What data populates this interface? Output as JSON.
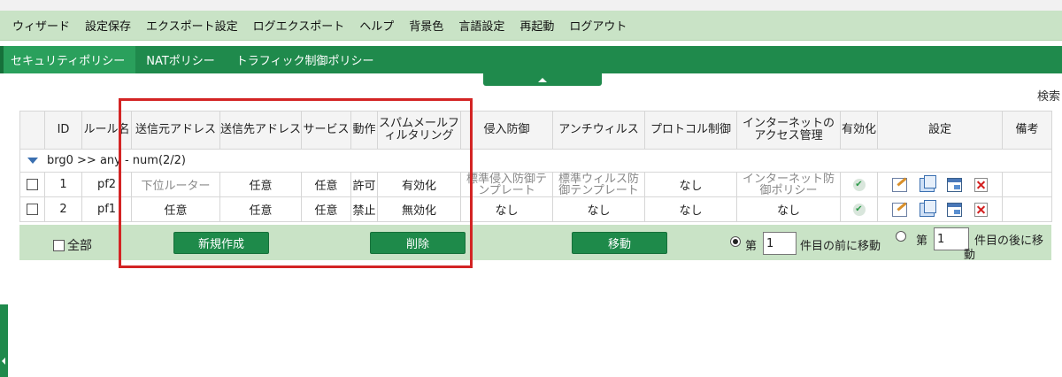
{
  "menu": [
    "ウィザード",
    "設定保存",
    "エクスポート設定",
    "ログエクスポート",
    "ヘルプ",
    "背景色",
    "言語設定",
    "再起動",
    "ログアウト"
  ],
  "tabs": [
    "セキュリティポリシー",
    "NATポリシー",
    "トラフィック制御ポリシー"
  ],
  "search_label": "検索",
  "columns": {
    "id": "ID",
    "rule_name": "ルール名",
    "src": "送信元アドレス",
    "dst": "送信先アドレス",
    "service": "サービス",
    "action": "動作",
    "spam": "スパムメールフィルタリング",
    "ips": "侵入防御",
    "av": "アンチウィルス",
    "protocol": "プロトコル制御",
    "internet": "インターネットのアクセス管理",
    "enabled": "有効化",
    "settings": "設定",
    "notes": "備考"
  },
  "group_label": "brg0 >> any - num(2/2)",
  "rows": [
    {
      "id": "1",
      "name": "pf2",
      "src": "下位ルーター",
      "dst": "任意",
      "service": "任意",
      "action": "許可",
      "spam": "有効化",
      "ips": "標準侵入防御テンプレート",
      "av": "標準ウィルス防御テンプレート",
      "protocol": "なし",
      "internet": "インターネット防御ポリシー",
      "notes": ""
    },
    {
      "id": "2",
      "name": "pf1",
      "src": "任意",
      "dst": "任意",
      "service": "任意",
      "action": "禁止",
      "spam": "無効化",
      "ips": "なし",
      "av": "なし",
      "protocol": "なし",
      "internet": "なし",
      "notes": ""
    }
  ],
  "actions": {
    "select_all": "全部",
    "new": "新規作成",
    "delete": "削除",
    "move": "移動",
    "dai": "第",
    "before_suffix": "件目の前に移動",
    "before_value": "1",
    "after_value": "1",
    "after_suffix_1": "件目の後に移",
    "after_suffix_2": "動"
  },
  "colors": {
    "menu_bg": "#c9e3c6",
    "tab_bg": "#1f8a4c",
    "button_bg": "#1e8a4a",
    "highlight": "#d32424"
  }
}
